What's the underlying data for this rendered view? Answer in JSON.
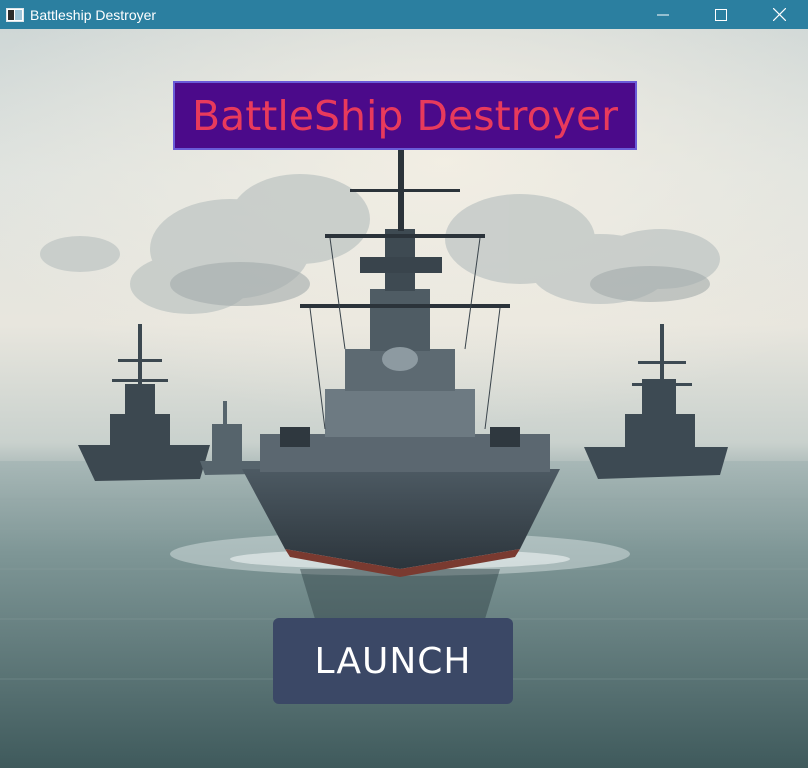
{
  "window": {
    "title": "Battleship Destroyer",
    "controls": [
      "minimize-icon",
      "maximize-icon",
      "close-icon"
    ],
    "titlebar_color": "#2b7fa0"
  },
  "game": {
    "banner_title": "BattleShip Destroyer",
    "banner_bg": "#4b0a8a",
    "banner_text_color": "#e83a5c",
    "launch_label": "LAUNCH",
    "launch_bg": "#3b4866",
    "background": "naval fleet at sea illustration"
  }
}
